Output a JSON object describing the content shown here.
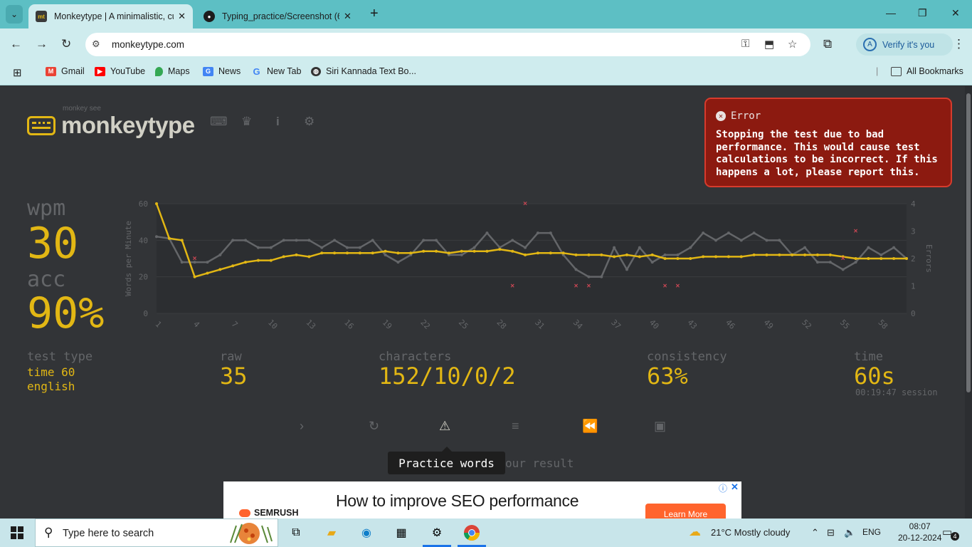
{
  "browser": {
    "tabs": [
      {
        "title": "Monkeytype | A minimalistic, customizable typing test",
        "favicon": "mt",
        "active": true
      },
      {
        "title": "Typing_practice/Screenshot (6).png",
        "favicon": "github-icon",
        "active": false
      }
    ],
    "url": "monkeytype.com",
    "profile_label": "Verify it's you",
    "profile_initial": "A",
    "bookmarks": [
      "Gmail",
      "YouTube",
      "Maps",
      "News",
      "New Tab",
      "Siri Kannada Text Bo...",
      "All Bookmarks"
    ]
  },
  "app": {
    "logo_text": "monkeytype",
    "logo_sub": "monkey see",
    "nav_icons": [
      "keyboard-icon",
      "crown-icon",
      "info-icon",
      "gear-icon"
    ]
  },
  "error": {
    "title": "Error",
    "message": "Stopping the test due to bad performance. This would cause test calculations to be incorrect. If this happens a lot, please report this."
  },
  "result": {
    "wpm_label": "wpm",
    "wpm": "30",
    "acc_label": "acc",
    "acc": "90%",
    "test_type_label": "test type",
    "test_type_line1": "time 60",
    "test_type_line2": "english",
    "raw_label": "raw",
    "raw": "35",
    "characters_label": "characters",
    "characters": "152/10/0/2",
    "consistency_label": "consistency",
    "consistency": "63%",
    "time_label": "time",
    "time": "60s",
    "session": "00:19:47 session"
  },
  "actions": {
    "icons": [
      "next-test-icon",
      "restart-icon",
      "practice-words-icon",
      "words-history-icon",
      "replay-icon",
      "screenshot-icon"
    ],
    "tooltip": "Practice words",
    "behind_text": "our result"
  },
  "ad": {
    "headline": "How to improve SEO performance",
    "brand": "SEMRUSH",
    "cta": "Learn More"
  },
  "taskbar": {
    "search_placeholder": "Type here to search",
    "weather": "21°C  Mostly cloudy",
    "language": "ENG",
    "time": "08:07",
    "date": "20-12-2024",
    "notifications": "4"
  },
  "colors": {
    "accent": "#e2b714",
    "text": "#d1d0c5",
    "sub": "#646669",
    "background": "#323437",
    "error_bg": "#8c1a10",
    "error_marker": "#ca4754"
  },
  "chart_data": {
    "type": "line",
    "ylabel": "Words per Minute",
    "y2label": "Errors",
    "ylim": [
      0,
      60
    ],
    "y2lim": [
      0,
      4
    ],
    "yticks": [
      "0",
      "20",
      "40",
      "60"
    ],
    "y2ticks": [
      "0",
      "1",
      "2",
      "3",
      "4"
    ],
    "xticks": [
      "1",
      "4",
      "7",
      "10",
      "13",
      "16",
      "19",
      "22",
      "25",
      "28",
      "31",
      "34",
      "37",
      "40",
      "43",
      "46",
      "49",
      "52",
      "55",
      "58"
    ],
    "x": [
      1,
      2,
      3,
      4,
      5,
      6,
      7,
      8,
      9,
      10,
      11,
      12,
      13,
      14,
      15,
      16,
      17,
      18,
      19,
      20,
      21,
      22,
      23,
      24,
      25,
      26,
      27,
      28,
      29,
      30,
      31,
      32,
      33,
      34,
      35,
      36,
      37,
      38,
      39,
      40,
      41,
      42,
      43,
      44,
      45,
      46,
      47,
      48,
      49,
      50,
      51,
      52,
      53,
      54,
      55,
      56,
      57,
      58,
      59,
      60
    ],
    "series": [
      {
        "name": "wpm",
        "color": "#e2b714",
        "values": [
          60,
          41,
          40,
          20,
          22,
          24,
          26,
          28,
          29,
          29,
          31,
          32,
          31,
          33,
          33,
          33,
          33,
          33,
          34,
          33,
          33,
          34,
          34,
          33,
          34,
          34,
          34,
          35,
          34,
          32,
          33,
          33,
          33,
          32,
          32,
          32,
          31,
          32,
          31,
          32,
          30,
          30,
          30,
          31,
          31,
          31,
          31,
          32,
          32,
          32,
          32,
          32,
          32,
          32,
          31,
          30,
          30,
          30,
          30,
          30
        ]
      },
      {
        "name": "raw",
        "color": "#646669",
        "values": [
          42,
          41,
          28,
          28,
          28,
          32,
          40,
          40,
          36,
          36,
          40,
          40,
          40,
          36,
          40,
          36,
          36,
          40,
          32,
          28,
          32,
          40,
          40,
          32,
          32,
          36,
          44,
          36,
          40,
          36,
          44,
          44,
          32,
          24,
          20,
          20,
          36,
          24,
          36,
          28,
          32,
          32,
          36,
          44,
          40,
          44,
          40,
          44,
          40,
          40,
          32,
          36,
          28,
          28,
          24,
          28,
          36,
          32,
          36,
          30
        ]
      },
      {
        "name": "errors",
        "color": "#ca4754",
        "points": [
          [
            4,
            2
          ],
          [
            29,
            1
          ],
          [
            30,
            4
          ],
          [
            34,
            1
          ],
          [
            35,
            1
          ],
          [
            41,
            1
          ],
          [
            42,
            1
          ],
          [
            55,
            2
          ],
          [
            56,
            3
          ]
        ]
      }
    ]
  }
}
